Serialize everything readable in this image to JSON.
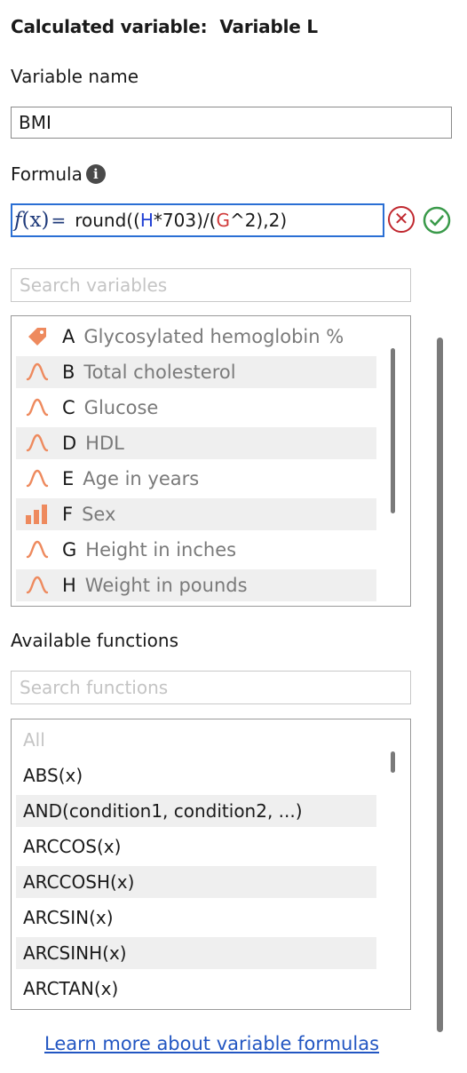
{
  "panel": {
    "title_prefix": "Calculated variable:",
    "title_variable": "Variable L"
  },
  "variable_name": {
    "label": "Variable name",
    "value": "BMI"
  },
  "formula": {
    "label": "Formula",
    "info_icon": "info-icon",
    "fx_f": "f",
    "fx_x": "(x)",
    "equals": "=",
    "part1": "round((",
    "ref1": "H",
    "part2": "*703)/(",
    "ref2": "G",
    "part3": "^2),2)",
    "cancel_icon": "cancel-circle-icon",
    "confirm_icon": "check-circle-icon",
    "colors": {
      "ref_h": "#1f3fd4",
      "ref_g": "#d03a3a",
      "accent": "#2a6fd4",
      "cancel": "#c0282f",
      "confirm": "#3a9a4a"
    }
  },
  "variables": {
    "search_placeholder": "Search variables",
    "items": [
      {
        "icon": "tag-icon",
        "letter": "A",
        "name": "Glycosylated hemoglobin %"
      },
      {
        "icon": "distribution-curve-icon",
        "letter": "B",
        "name": "Total cholesterol"
      },
      {
        "icon": "distribution-curve-icon",
        "letter": "C",
        "name": "Glucose"
      },
      {
        "icon": "distribution-curve-icon",
        "letter": "D",
        "name": "HDL"
      },
      {
        "icon": "distribution-curve-icon",
        "letter": "E",
        "name": "Age in years"
      },
      {
        "icon": "bar-chart-icon",
        "letter": "F",
        "name": "Sex"
      },
      {
        "icon": "distribution-curve-icon",
        "letter": "G",
        "name": "Height in inches"
      },
      {
        "icon": "distribution-curve-icon",
        "letter": "H",
        "name": "Weight in pounds"
      }
    ],
    "icon_color": "#ee8a5e"
  },
  "functions": {
    "label": "Available functions",
    "search_placeholder": "Search functions",
    "items": [
      "All",
      "ABS(x)",
      "AND(condition1, condition2, ...)",
      "ARCCOS(x)",
      "ARCCOSH(x)",
      "ARCSIN(x)",
      "ARCSINH(x)",
      "ARCTAN(x)"
    ]
  },
  "footer": {
    "learn_more_link": "Learn more about variable formulas"
  }
}
